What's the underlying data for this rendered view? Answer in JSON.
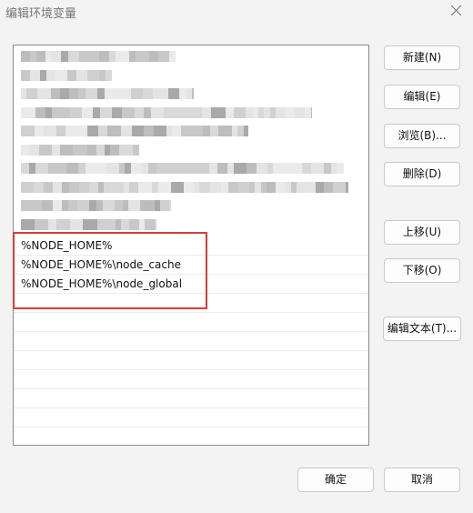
{
  "window": {
    "title": "编辑环境变量"
  },
  "list": {
    "visible_entries": [
      "%NODE_HOME%",
      "%NODE_HOME%\\node_cache",
      "%NODE_HOME%\\node_global"
    ]
  },
  "buttons": {
    "new": "新建(N)",
    "edit": "编辑(E)",
    "browse": "浏览(B)...",
    "delete": "删除(D)",
    "move_up": "上移(U)",
    "move_down": "下移(O)",
    "edit_text": "编辑文本(T)...",
    "ok": "确定",
    "cancel": "取消"
  },
  "colors": {
    "highlight": "#d93a3a",
    "background": "#f3f3f3"
  }
}
